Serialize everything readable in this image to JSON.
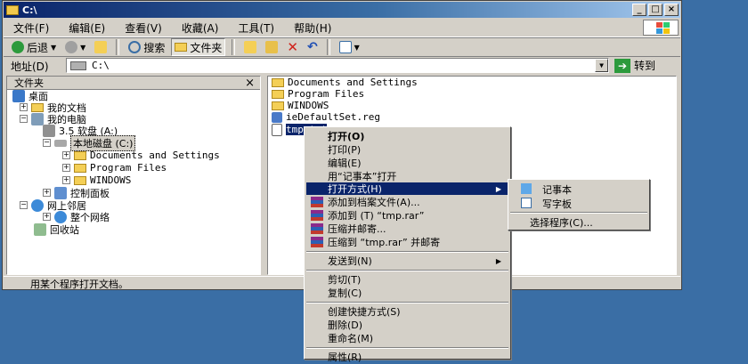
{
  "window": {
    "title": "C:\\",
    "buttons": {
      "minimize": "_",
      "maximize": "□",
      "close": "×"
    }
  },
  "menubar": {
    "items": [
      "文件(F)",
      "编辑(E)",
      "查看(V)",
      "收藏(A)",
      "工具(T)",
      "帮助(H)"
    ]
  },
  "toolbar": {
    "back": "后退",
    "search": "搜索",
    "folders": "文件夹"
  },
  "address": {
    "label": "地址(D)",
    "value": "C:\\",
    "go": "转到"
  },
  "folders_pane": {
    "header": "文件夹",
    "close": "×",
    "tree": [
      {
        "label": "桌面"
      },
      {
        "label": "我的文档",
        "exp": "+"
      },
      {
        "label": "我的电脑",
        "exp": "−"
      },
      {
        "label": "3.5 软盘 (A:)"
      },
      {
        "label": "本地磁盘 (C:)",
        "exp": "−"
      },
      {
        "label": "Documents and Settings",
        "exp": "+"
      },
      {
        "label": "Program Files",
        "exp": "+"
      },
      {
        "label": "WINDOWS",
        "exp": "+"
      },
      {
        "label": "控制面板",
        "exp": "+"
      },
      {
        "label": "网上邻居",
        "exp": "−"
      },
      {
        "label": "整个网络",
        "exp": "+"
      },
      {
        "label": "回收站"
      }
    ]
  },
  "files": [
    {
      "name": "Documents and Settings"
    },
    {
      "name": "Program Files"
    },
    {
      "name": "WINDOWS"
    },
    {
      "name": "ieDefaultSet.reg"
    },
    {
      "name": "tmp.txt"
    }
  ],
  "status": "用某个程序打开文档。",
  "context_menu": {
    "items": [
      "打开(O)",
      "打印(P)",
      "编辑(E)",
      "用“记事本”打开",
      "打开方式(H)",
      "添加到档案文件(A)...",
      "添加到 (T) “tmp.rar”",
      "压缩并邮寄...",
      "压缩到 “tmp.rar” 并邮寄",
      "发送到(N)",
      "剪切(T)",
      "复制(C)",
      "创建快捷方式(S)",
      "删除(D)",
      "重命名(M)",
      "属性(R)"
    ]
  },
  "submenu": {
    "items": [
      "记事本",
      "写字板",
      "选择程序(C)..."
    ]
  },
  "colors": {
    "desktop": "#3a6ea5",
    "title_active": "#0a246a",
    "highlight": "#0a246a",
    "face": "#d4d0c8"
  }
}
